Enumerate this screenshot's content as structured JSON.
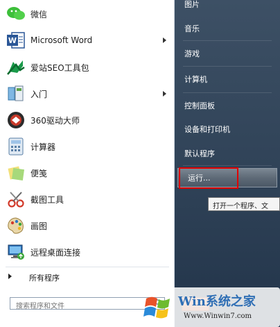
{
  "left_menu": {
    "items": [
      {
        "label": "微信",
        "icon": "wechat-icon",
        "arrow": false
      },
      {
        "label": "Microsoft Word",
        "icon": "word-icon",
        "arrow": true
      },
      {
        "label": "爱站SEO工具包",
        "icon": "aizhan-seo-icon",
        "arrow": false
      },
      {
        "label": "入门",
        "icon": "getting-started-icon",
        "arrow": true
      },
      {
        "label": "360驱动大师",
        "icon": "driver-master-icon",
        "arrow": false
      },
      {
        "label": "计算器",
        "icon": "calculator-icon",
        "arrow": false
      },
      {
        "label": "便笺",
        "icon": "sticky-notes-icon",
        "arrow": false
      },
      {
        "label": "截图工具",
        "icon": "snipping-tool-icon",
        "arrow": false
      },
      {
        "label": "画图",
        "icon": "paint-icon",
        "arrow": false
      },
      {
        "label": "远程桌面连接",
        "icon": "remote-desktop-icon",
        "arrow": false
      }
    ],
    "all_programs": "所有程序",
    "search_placeholder": "搜索程序和文件"
  },
  "right_menu": {
    "items": [
      "图片",
      "音乐",
      "游戏",
      "计算机",
      "控制面板",
      "设备和打印机",
      "默认程序",
      "运行..."
    ],
    "highlighted": "运行...",
    "tooltip": "打开一个程序、文"
  },
  "watermark": {
    "site": "Win系统之家",
    "url": "Www.Winwin7.com"
  },
  "colors": {
    "highlight_border": "#e00000",
    "right_panel": "#2f4257"
  }
}
